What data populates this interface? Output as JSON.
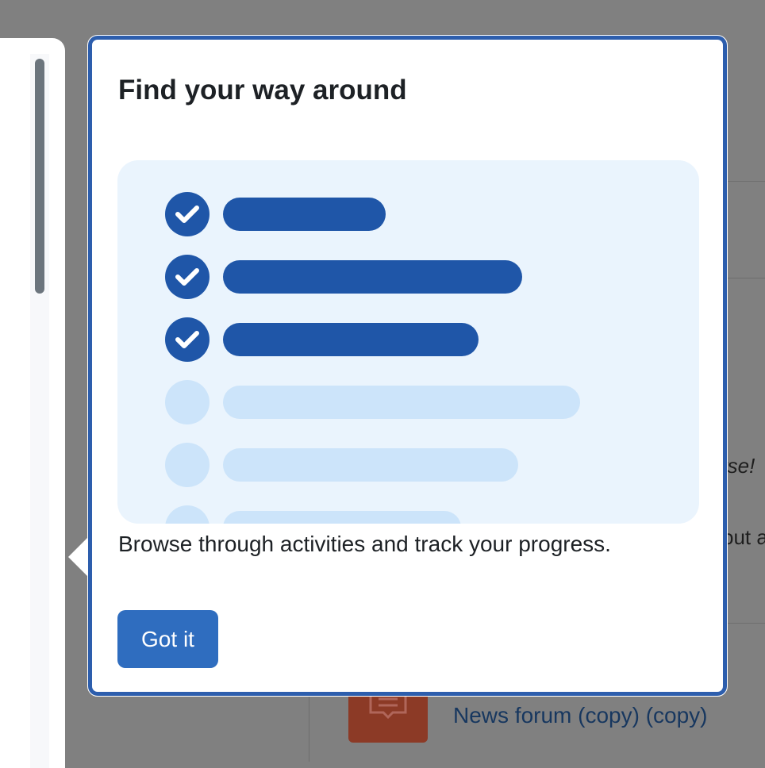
{
  "background": {
    "italic_fragment": "rse!",
    "text_fragment": "out a",
    "forum_link": "News forum (copy) (copy)"
  },
  "tour": {
    "title": "Find your way around",
    "body": "Browse through activities and track your progress.",
    "button_label": "Got it",
    "checklist": [
      {
        "status": "done",
        "bar_fraction": 0.37
      },
      {
        "status": "done",
        "bar_fraction": 0.68
      },
      {
        "status": "done",
        "bar_fraction": 0.58
      },
      {
        "status": "todo",
        "bar_fraction": 0.81
      },
      {
        "status": "todo",
        "bar_fraction": 0.67
      },
      {
        "status": "todo",
        "bar_fraction": 0.54
      }
    ]
  },
  "colors": {
    "accent": "#2f6dbf",
    "done": "#1f56a8",
    "todo": "#cce4fa",
    "illustration_bg": "#eaf4fd",
    "forum_icon": "#8c3a26"
  },
  "icons": {
    "check": "check-icon",
    "forum": "forum-icon"
  }
}
